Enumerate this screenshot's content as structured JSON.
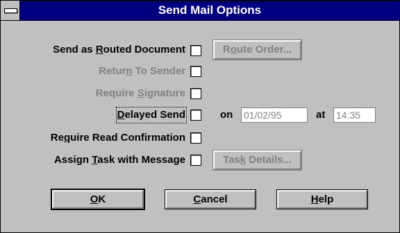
{
  "window": {
    "title": "Send Mail Options"
  },
  "options": {
    "routed": {
      "label_pre": "Send as ",
      "label_u": "R",
      "label_post": "outed Document",
      "checked": false
    },
    "return": {
      "label_pre": "Retur",
      "label_u": "n",
      "label_post": " To Sender",
      "checked": false,
      "enabled": false
    },
    "signature": {
      "label_pre": "Require ",
      "label_u": "S",
      "label_post": "ignature",
      "checked": false,
      "enabled": false
    },
    "delayed": {
      "label_u": "D",
      "label_post": "elayed Send",
      "checked": false
    },
    "readconf": {
      "label_pre": "Re",
      "label_u": "q",
      "label_post": "uire Read Confirmation",
      "checked": false
    },
    "task": {
      "label_pre": "Assign ",
      "label_u": "T",
      "label_post": "ask with Message",
      "checked": false
    }
  },
  "route_button": {
    "pre": "R",
    "u": "o",
    "post": "ute Order..."
  },
  "task_button": {
    "pre": "Tas",
    "u": "k",
    "post": " Details..."
  },
  "delayed_fields": {
    "on_label": "on",
    "date": "01/02/95",
    "at_label": "at",
    "time": "14:35"
  },
  "buttons": {
    "ok": {
      "u": "O",
      "post": "K"
    },
    "cancel": {
      "u": "C",
      "post": "ancel"
    },
    "help": {
      "u": "H",
      "post": "elp"
    }
  },
  "colors": {
    "titlebar": "#000080",
    "face": "#c0c0c0",
    "disabled": "#808080"
  }
}
